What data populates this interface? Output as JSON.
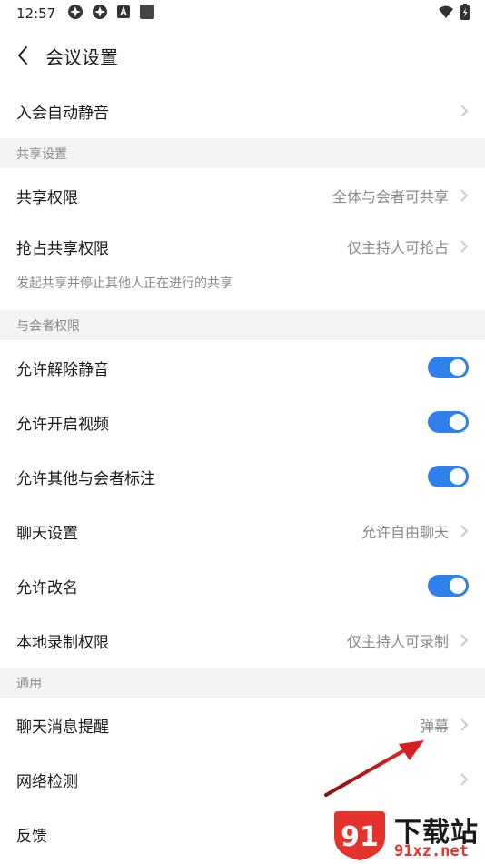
{
  "status_bar": {
    "time": "12:57",
    "icons": [
      "app-notify-icon",
      "app-notify-icon",
      "a-box-icon",
      "square-icon"
    ],
    "right_icons": [
      "wifi-icon",
      "battery-icon"
    ]
  },
  "header": {
    "title": "会议设置"
  },
  "rows_top": [
    {
      "label": "入会自动静音"
    }
  ],
  "sections": {
    "share": "共享设置",
    "participants": "与会者权限",
    "general": "通用"
  },
  "share_rows": [
    {
      "label": "共享权限",
      "value": "全体与会者可共享"
    },
    {
      "label": "抢占共享权限",
      "value": "仅主持人可抢占"
    }
  ],
  "share_hint": "发起共享并停止其他人正在进行的共享",
  "participant_rows": [
    {
      "label": "允许解除静音",
      "toggle": true
    },
    {
      "label": "允许开启视频",
      "toggle": true
    },
    {
      "label": "允许其他与会者标注",
      "toggle": true
    },
    {
      "label": "聊天设置",
      "value": "允许自由聊天"
    },
    {
      "label": "允许改名",
      "toggle": true
    },
    {
      "label": "本地录制权限",
      "value": "仅主持人可录制"
    }
  ],
  "general_rows": [
    {
      "label": "聊天消息提醒",
      "value": "弹幕"
    },
    {
      "label": "网络检测"
    },
    {
      "label": "反馈"
    }
  ],
  "watermark": {
    "title": "下载站",
    "domain": "91xz.net",
    "badge_text": "91"
  },
  "colors": {
    "accent": "#2f80ed",
    "section_bg": "#f2f3f5",
    "annotation_arrow": "#d62020",
    "watermark_red": "#e5322d"
  }
}
